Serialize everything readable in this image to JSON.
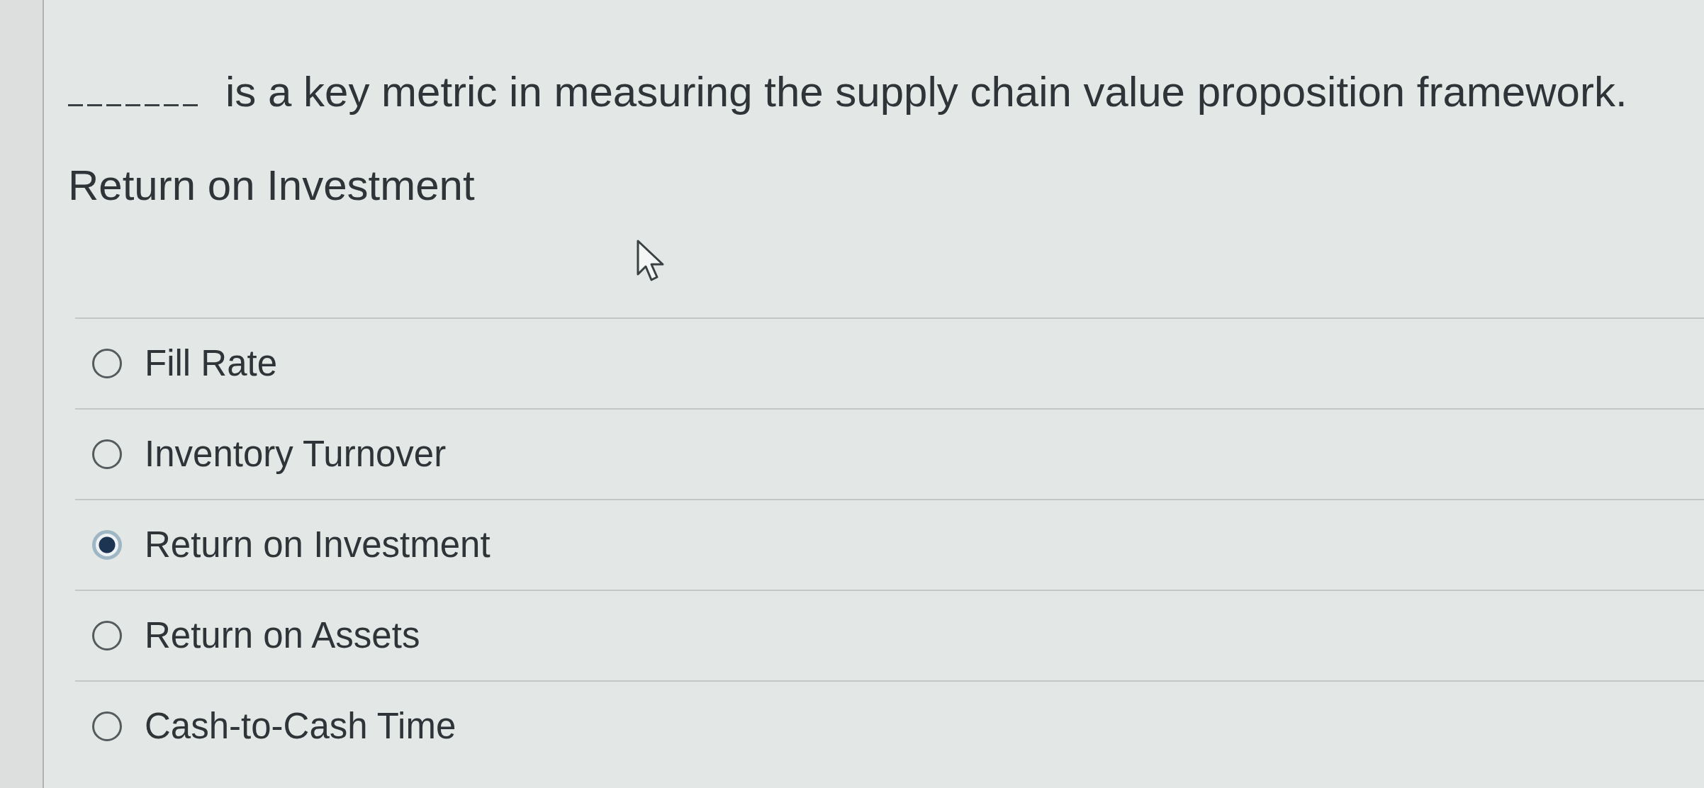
{
  "question": {
    "parts": [
      {
        "kind": "blank"
      },
      {
        "kind": "text",
        "text": "is a key metric in measuring the supply chain value proposition framework."
      }
    ]
  },
  "answer": {
    "text": "Return on Investment"
  },
  "options": [
    {
      "label": "Fill Rate",
      "selected": false
    },
    {
      "label": "Inventory Turnover",
      "selected": false
    },
    {
      "label": "Return on Investment",
      "selected": true
    },
    {
      "label": "Return on Assets",
      "selected": false
    },
    {
      "label": "Cash-to-Cash Time",
      "selected": false
    }
  ]
}
